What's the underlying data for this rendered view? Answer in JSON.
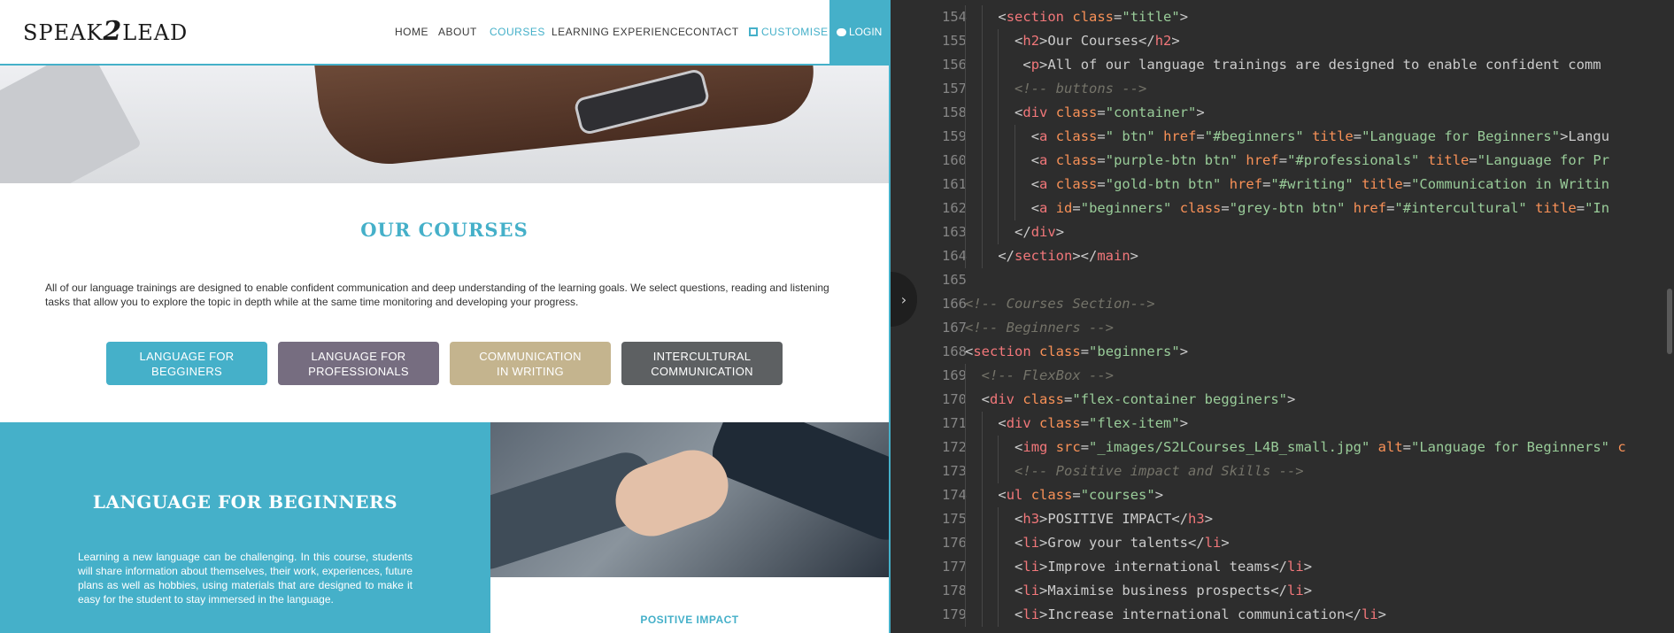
{
  "website": {
    "logo": {
      "prefix": "SPEAK",
      "digit": "2",
      "suffix": "LEAD"
    },
    "nav": {
      "home": "HOME",
      "about": "ABOUT",
      "courses": "COURSES",
      "learning_experience": "LEARNING EXPERIENCE",
      "contact": "CONTACT",
      "customise": "CUSTOMISE",
      "login": "LOGIN"
    },
    "courses_section": {
      "title": "OUR COURSES",
      "intro": "All of our language trainings are designed to enable confident communication and deep understanding of the learning goals. We select questions, reading and listening tasks that allow you to explore the topic in depth while at the same time monitoring and developing your progress.",
      "buttons": {
        "beginners": {
          "line1": "LANGUAGE FOR",
          "line2": "BEGGINERS"
        },
        "professionals": {
          "line1": "LANGUAGE FOR",
          "line2": "PROFESSIONALS"
        },
        "writing": {
          "line1": "COMMUNICATION",
          "line2": "IN WRITING"
        },
        "intercultural": {
          "line1": "INTERCULTURAL",
          "line2": "COMMUNICATION"
        }
      }
    },
    "beginners_section": {
      "title": "LANGUAGE FOR BEGINNERS",
      "text": "Learning a new language can be challenging. In this course, students will share information about themselves, their work, experiences, future plans as well as hobbies, using materials that are designed to make it easy for the student to stay immersed in the language.",
      "positive_impact_heading": "POSITIVE IMPACT"
    },
    "colors": {
      "accent": "#45b0c9",
      "purple_btn": "#766d80",
      "gold_btn": "#c4b48e",
      "grey_btn": "#5d6062"
    }
  },
  "editor": {
    "toggle_icon": "chevron-right-icon",
    "toggle_glyph": "›",
    "lines": [
      {
        "n": "154",
        "indent": 2,
        "tokens": [
          [
            "punc",
            "<"
          ],
          [
            "tag",
            "section"
          ],
          [
            "punc",
            " "
          ],
          [
            "attr",
            "class"
          ],
          [
            "punc",
            "="
          ],
          [
            "str",
            "\"title\""
          ],
          [
            "punc",
            ">"
          ]
        ]
      },
      {
        "n": "155",
        "indent": 3,
        "tokens": [
          [
            "punc",
            "<"
          ],
          [
            "tag",
            "h2"
          ],
          [
            "punc",
            ">"
          ],
          [
            "txt",
            "Our Courses"
          ],
          [
            "punc",
            "</"
          ],
          [
            "tag",
            "h2"
          ],
          [
            "punc",
            ">"
          ]
        ]
      },
      {
        "n": "156",
        "indent": 3,
        "tokens": [
          [
            "punc",
            " <"
          ],
          [
            "tag",
            "p"
          ],
          [
            "punc",
            ">"
          ],
          [
            "txt",
            "All of our language trainings are designed to enable confident comm"
          ]
        ]
      },
      {
        "n": "157",
        "indent": 3,
        "tokens": [
          [
            "com",
            "<!-- buttons -->"
          ]
        ]
      },
      {
        "n": "158",
        "indent": 3,
        "tokens": [
          [
            "punc",
            "<"
          ],
          [
            "tag",
            "div"
          ],
          [
            "punc",
            " "
          ],
          [
            "attr",
            "class"
          ],
          [
            "punc",
            "="
          ],
          [
            "str",
            "\"container\""
          ],
          [
            "punc",
            ">"
          ]
        ]
      },
      {
        "n": "159",
        "indent": 4,
        "tokens": [
          [
            "punc",
            "<"
          ],
          [
            "tag",
            "a"
          ],
          [
            "punc",
            " "
          ],
          [
            "attr",
            "class"
          ],
          [
            "punc",
            "="
          ],
          [
            "str",
            "\" btn\""
          ],
          [
            "punc",
            " "
          ],
          [
            "attr",
            "href"
          ],
          [
            "punc",
            "="
          ],
          [
            "str",
            "\"#beginners\""
          ],
          [
            "punc",
            " "
          ],
          [
            "attr",
            "title"
          ],
          [
            "punc",
            "="
          ],
          [
            "str",
            "\"Language for Beginners\""
          ],
          [
            "punc",
            ">"
          ],
          [
            "txt",
            "Langu"
          ]
        ]
      },
      {
        "n": "160",
        "indent": 4,
        "tokens": [
          [
            "punc",
            "<"
          ],
          [
            "tag",
            "a"
          ],
          [
            "punc",
            " "
          ],
          [
            "attr",
            "class"
          ],
          [
            "punc",
            "="
          ],
          [
            "str",
            "\"purple-btn btn\""
          ],
          [
            "punc",
            " "
          ],
          [
            "attr",
            "href"
          ],
          [
            "punc",
            "="
          ],
          [
            "str",
            "\"#professionals\""
          ],
          [
            "punc",
            " "
          ],
          [
            "attr",
            "title"
          ],
          [
            "punc",
            "="
          ],
          [
            "str",
            "\"Language for Pr"
          ]
        ]
      },
      {
        "n": "161",
        "indent": 4,
        "tokens": [
          [
            "punc",
            "<"
          ],
          [
            "tag",
            "a"
          ],
          [
            "punc",
            " "
          ],
          [
            "attr",
            "class"
          ],
          [
            "punc",
            "="
          ],
          [
            "str",
            "\"gold-btn btn\""
          ],
          [
            "punc",
            " "
          ],
          [
            "attr",
            "href"
          ],
          [
            "punc",
            "="
          ],
          [
            "str",
            "\"#writing\""
          ],
          [
            "punc",
            " "
          ],
          [
            "attr",
            "title"
          ],
          [
            "punc",
            "="
          ],
          [
            "str",
            "\"Communication in Writin"
          ]
        ]
      },
      {
        "n": "162",
        "indent": 4,
        "tokens": [
          [
            "punc",
            "<"
          ],
          [
            "tag",
            "a"
          ],
          [
            "punc",
            " "
          ],
          [
            "attr",
            "id"
          ],
          [
            "punc",
            "="
          ],
          [
            "str",
            "\"beginners\""
          ],
          [
            "punc",
            " "
          ],
          [
            "attr",
            "class"
          ],
          [
            "punc",
            "="
          ],
          [
            "str",
            "\"grey-btn btn\""
          ],
          [
            "punc",
            " "
          ],
          [
            "attr",
            "href"
          ],
          [
            "punc",
            "="
          ],
          [
            "str",
            "\"#intercultural\""
          ],
          [
            "punc",
            " "
          ],
          [
            "attr",
            "title"
          ],
          [
            "punc",
            "="
          ],
          [
            "str",
            "\"In"
          ]
        ]
      },
      {
        "n": "163",
        "indent": 3,
        "tokens": [
          [
            "punc",
            "</"
          ],
          [
            "tag",
            "div"
          ],
          [
            "punc",
            ">"
          ]
        ]
      },
      {
        "n": "164",
        "indent": 2,
        "tokens": [
          [
            "punc",
            "</"
          ],
          [
            "tag",
            "section"
          ],
          [
            "punc",
            "></"
          ],
          [
            "tag",
            "main"
          ],
          [
            "punc",
            ">"
          ]
        ]
      },
      {
        "n": "165",
        "indent": 0,
        "tokens": []
      },
      {
        "n": "166",
        "indent": 0,
        "tokens": [
          [
            "com",
            "<!-- Courses Section-->"
          ]
        ]
      },
      {
        "n": "167",
        "indent": 0,
        "tokens": [
          [
            "com",
            "<!-- Beginners -->"
          ]
        ]
      },
      {
        "n": "168",
        "indent": 0,
        "tokens": [
          [
            "punc",
            "<"
          ],
          [
            "tag",
            "section"
          ],
          [
            "punc",
            " "
          ],
          [
            "attr",
            "class"
          ],
          [
            "punc",
            "="
          ],
          [
            "str",
            "\"beginners\""
          ],
          [
            "punc",
            ">"
          ]
        ]
      },
      {
        "n": "169",
        "indent": 1,
        "tokens": [
          [
            "com",
            "<!-- FlexBox -->"
          ]
        ]
      },
      {
        "n": "170",
        "indent": 1,
        "tokens": [
          [
            "punc",
            "<"
          ],
          [
            "tag",
            "div"
          ],
          [
            "punc",
            " "
          ],
          [
            "attr",
            "class"
          ],
          [
            "punc",
            "="
          ],
          [
            "str",
            "\"flex-container begginers\""
          ],
          [
            "punc",
            ">"
          ]
        ]
      },
      {
        "n": "171",
        "indent": 2,
        "tokens": [
          [
            "punc",
            "<"
          ],
          [
            "tag",
            "div"
          ],
          [
            "punc",
            " "
          ],
          [
            "attr",
            "class"
          ],
          [
            "punc",
            "="
          ],
          [
            "str",
            "\"flex-item\""
          ],
          [
            "punc",
            ">"
          ]
        ]
      },
      {
        "n": "172",
        "indent": 3,
        "tokens": [
          [
            "punc",
            "<"
          ],
          [
            "tag",
            "img"
          ],
          [
            "punc",
            " "
          ],
          [
            "attr",
            "src"
          ],
          [
            "punc",
            "="
          ],
          [
            "str",
            "\"_images/S2LCourses_L4B_small.jpg\""
          ],
          [
            "punc",
            " "
          ],
          [
            "attr",
            "alt"
          ],
          [
            "punc",
            "="
          ],
          [
            "str",
            "\"Language for Beginners\""
          ],
          [
            "punc",
            " "
          ],
          [
            "attr",
            "c"
          ]
        ]
      },
      {
        "n": "173",
        "indent": 3,
        "tokens": [
          [
            "com",
            "<!-- Positive impact and Skills -->"
          ]
        ]
      },
      {
        "n": "174",
        "indent": 2,
        "tokens": [
          [
            "punc",
            "<"
          ],
          [
            "tag",
            "ul"
          ],
          [
            "punc",
            " "
          ],
          [
            "attr",
            "class"
          ],
          [
            "punc",
            "="
          ],
          [
            "str",
            "\"courses\""
          ],
          [
            "punc",
            ">"
          ]
        ]
      },
      {
        "n": "175",
        "indent": 3,
        "tokens": [
          [
            "punc",
            "<"
          ],
          [
            "tag",
            "h3"
          ],
          [
            "punc",
            ">"
          ],
          [
            "txt",
            "POSITIVE IMPACT"
          ],
          [
            "punc",
            "</"
          ],
          [
            "tag",
            "h3"
          ],
          [
            "punc",
            ">"
          ]
        ]
      },
      {
        "n": "176",
        "indent": 3,
        "tokens": [
          [
            "punc",
            "<"
          ],
          [
            "tag",
            "li"
          ],
          [
            "punc",
            ">"
          ],
          [
            "txt",
            "Grow your talents"
          ],
          [
            "punc",
            "</"
          ],
          [
            "tag",
            "li"
          ],
          [
            "punc",
            ">"
          ]
        ]
      },
      {
        "n": "177",
        "indent": 3,
        "tokens": [
          [
            "punc",
            "<"
          ],
          [
            "tag",
            "li"
          ],
          [
            "punc",
            ">"
          ],
          [
            "txt",
            "Improve international teams"
          ],
          [
            "punc",
            "</"
          ],
          [
            "tag",
            "li"
          ],
          [
            "punc",
            ">"
          ]
        ]
      },
      {
        "n": "178",
        "indent": 3,
        "tokens": [
          [
            "punc",
            "<"
          ],
          [
            "tag",
            "li"
          ],
          [
            "punc",
            ">"
          ],
          [
            "txt",
            "Maximise business prospects"
          ],
          [
            "punc",
            "</"
          ],
          [
            "tag",
            "li"
          ],
          [
            "punc",
            ">"
          ]
        ]
      },
      {
        "n": "179",
        "indent": 3,
        "tokens": [
          [
            "punc",
            "<"
          ],
          [
            "tag",
            "li"
          ],
          [
            "punc",
            ">"
          ],
          [
            "txt",
            "Increase international communication"
          ],
          [
            "punc",
            "</"
          ],
          [
            "tag",
            "li"
          ],
          [
            "punc",
            ">"
          ]
        ]
      }
    ]
  }
}
